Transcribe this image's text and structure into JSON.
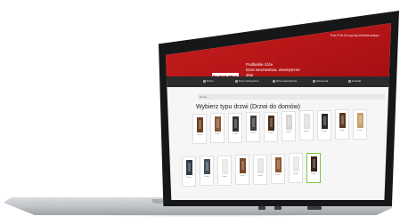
{
  "site": {
    "logo": "DELTA",
    "tagline_line1": "Podlaskie ćóźe",
    "tagline_line2": "Dzwi wezniestwa, wewnętrzne drwi",
    "header_right": "Pon-Pt 8-16 czynny infolinia sklepu"
  },
  "navbar": {
    "items": [
      {
        "label": "Drzwi",
        "icon": "door-icon"
      },
      {
        "label": "Dzwi zewnętrzne",
        "icon": "door-icon"
      },
      {
        "label": "Dzwi wewnętrzne",
        "icon": "door-icon"
      },
      {
        "label": "Akcesoria",
        "icon": "tag-icon"
      },
      {
        "label": "Kontakt",
        "icon": "phone-icon"
      }
    ]
  },
  "breadcrumb": {
    "home": "Home"
  },
  "page_title": "Wybierz typu drzwi (Drzwi do domów)",
  "products": {
    "row1": [
      {
        "label": "Drzwi",
        "color": "#6b3f22"
      },
      {
        "label": "Drzwi",
        "color": "#8b5a34"
      },
      {
        "label": "Drzwi",
        "color": "#2f3438"
      },
      {
        "label": "Drzwi",
        "color": "#3c3f43"
      },
      {
        "label": "Drzwi",
        "color": "#4a2b1a"
      },
      {
        "label": "Drzwi",
        "color": "#d7d4cf"
      },
      {
        "label": "Drzwi",
        "color": "#e4e2de"
      },
      {
        "label": "Drzwi",
        "color": "#2b2b2e"
      },
      {
        "label": "Drzwi",
        "color": "#5a3a24"
      },
      {
        "label": "Drzwi",
        "color": "#c9a06a"
      }
    ],
    "row2": [
      {
        "label": "Drzwi",
        "color": "#2d3c48"
      },
      {
        "label": "Drzwi",
        "color": "#46505a"
      },
      {
        "label": "Drzwi",
        "color": "#e9e9e9"
      },
      {
        "label": "Drzwi",
        "color": "#7b4a2a"
      },
      {
        "label": "Drzwi",
        "color": "#e6e4e0"
      },
      {
        "label": "Drzwi",
        "color": "#8c5a36"
      },
      {
        "label": "Drzwi",
        "color": "#e8e8e8"
      },
      {
        "label": "Drzwi",
        "color": "#3a2416"
      }
    ],
    "selected_index_row2": 7
  },
  "device": {
    "body_color": "#161718",
    "base_color": "#c3c6ca"
  }
}
